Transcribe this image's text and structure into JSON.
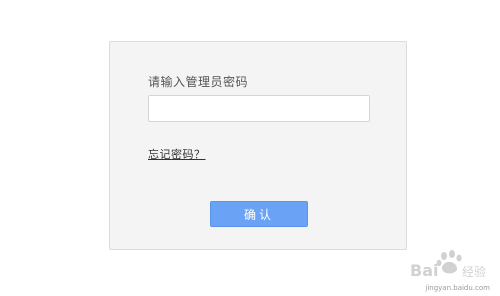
{
  "login": {
    "prompt": "请输入管理员密码",
    "password_value": "",
    "password_placeholder": "",
    "forgot_password": "忘记密码？",
    "confirm_label": "确认"
  },
  "watermark": {
    "logo_text": "Bai du 经验",
    "url": "jingyan.baidu.com"
  },
  "colors": {
    "button_bg": "#6aa3f5",
    "card_bg": "#f4f4f4"
  }
}
